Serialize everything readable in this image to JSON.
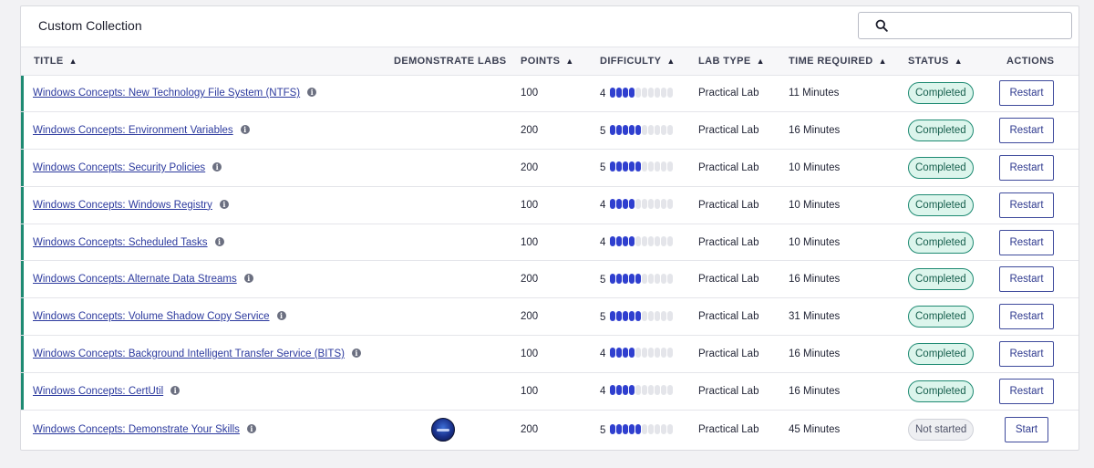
{
  "panel": {
    "title": "Custom Collection"
  },
  "search": {
    "icon": "search-icon",
    "value": ""
  },
  "columns": {
    "title": "TITLE",
    "demonstrate_labs": "DEMONSTRATE LABS",
    "points": "POINTS",
    "difficulty": "DIFFICULTY",
    "lab_type": "LAB TYPE",
    "time_required": "TIME REQUIRED",
    "status": "STATUS",
    "actions": "ACTIONS"
  },
  "colors": {
    "accent_completed": "#1e8a72",
    "difficulty_on": "#2f3fcf",
    "difficulty_off": "#e4e5ea",
    "link": "#2c3a9e"
  },
  "rows": [
    {
      "title": "Windows Concepts: New Technology File System (NTFS)",
      "points": "100",
      "difficulty": 4,
      "difficulty_label": "4",
      "lab_type": "Practical Lab",
      "time": "11 Minutes",
      "status": "Completed",
      "action": "Restart"
    },
    {
      "title": "Windows Concepts: Environment Variables",
      "points": "200",
      "difficulty": 5,
      "difficulty_label": "5",
      "lab_type": "Practical Lab",
      "time": "16 Minutes",
      "status": "Completed",
      "action": "Restart"
    },
    {
      "title": "Windows Concepts: Security Policies",
      "points": "200",
      "difficulty": 5,
      "difficulty_label": "5",
      "lab_type": "Practical Lab",
      "time": "10 Minutes",
      "status": "Completed",
      "action": "Restart"
    },
    {
      "title": "Windows Concepts: Windows Registry",
      "points": "100",
      "difficulty": 4,
      "difficulty_label": "4",
      "lab_type": "Practical Lab",
      "time": "10 Minutes",
      "status": "Completed",
      "action": "Restart"
    },
    {
      "title": "Windows Concepts: Scheduled Tasks",
      "points": "100",
      "difficulty": 4,
      "difficulty_label": "4",
      "lab_type": "Practical Lab",
      "time": "10 Minutes",
      "status": "Completed",
      "action": "Restart"
    },
    {
      "title": "Windows Concepts: Alternate Data Streams",
      "points": "200",
      "difficulty": 5,
      "difficulty_label": "5",
      "lab_type": "Practical Lab",
      "time": "16 Minutes",
      "status": "Completed",
      "action": "Restart"
    },
    {
      "title": "Windows Concepts: Volume Shadow Copy Service",
      "points": "200",
      "difficulty": 5,
      "difficulty_label": "5",
      "lab_type": "Practical Lab",
      "time": "31 Minutes",
      "status": "Completed",
      "action": "Restart"
    },
    {
      "title": "Windows Concepts: Background Intelligent Transfer Service (BITS)",
      "points": "100",
      "difficulty": 4,
      "difficulty_label": "4",
      "lab_type": "Practical Lab",
      "time": "16 Minutes",
      "status": "Completed",
      "action": "Restart"
    },
    {
      "title": "Windows Concepts: CertUtil",
      "points": "100",
      "difficulty": 4,
      "difficulty_label": "4",
      "lab_type": "Practical Lab",
      "time": "16 Minutes",
      "status": "Completed",
      "action": "Restart"
    },
    {
      "title": "Windows Concepts: Demonstrate Your Skills",
      "points": "200",
      "difficulty": 5,
      "difficulty_label": "5",
      "lab_type": "Practical Lab",
      "time": "45 Minutes",
      "status": "Not started",
      "action": "Start",
      "demonstrate_icon": "demonstrate-lab-badge-icon"
    }
  ],
  "difficulty_max": 10
}
